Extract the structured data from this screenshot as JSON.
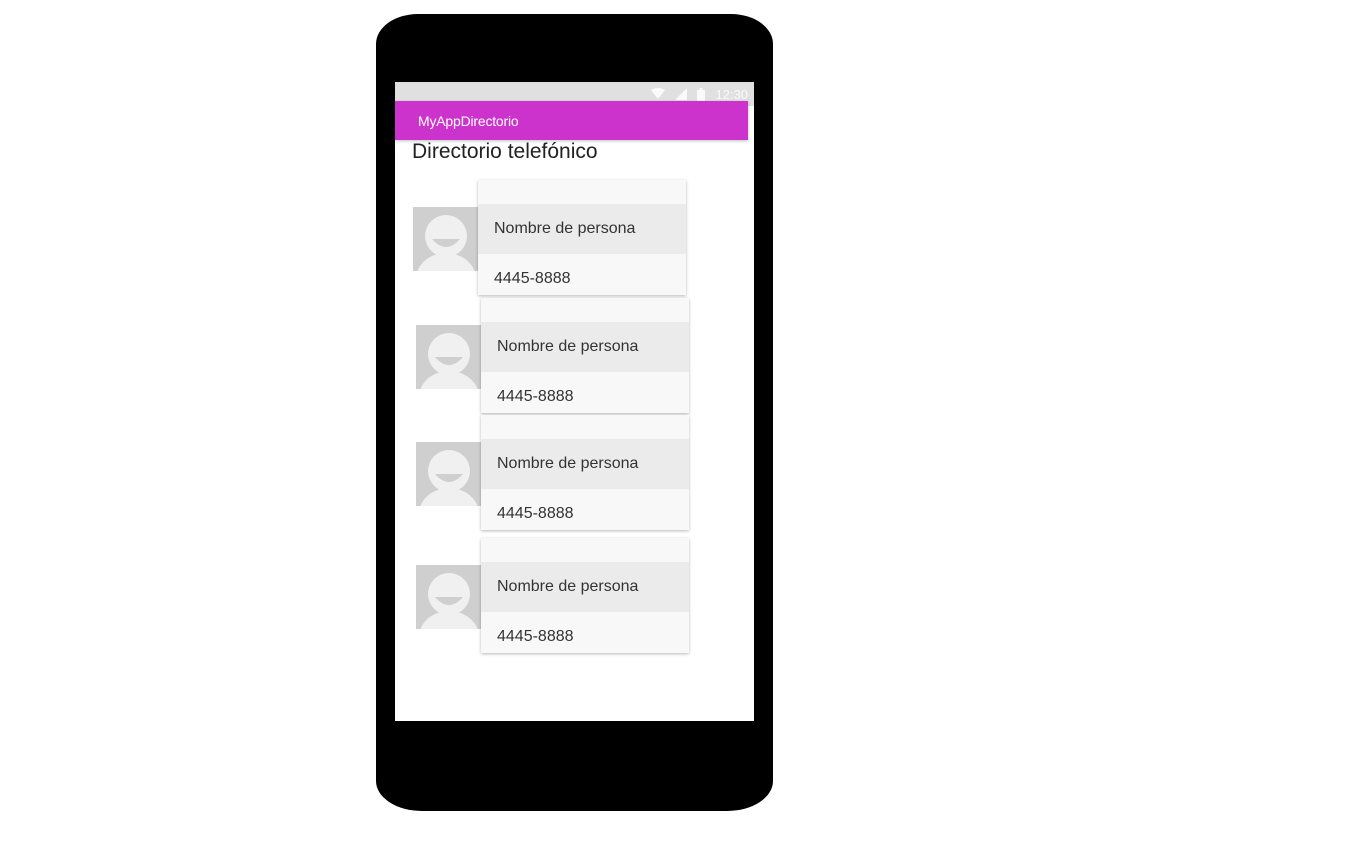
{
  "status_bar": {
    "time": "12:30",
    "icons": [
      "wifi-icon",
      "signal-icon",
      "battery-icon"
    ]
  },
  "app_bar": {
    "title": "MyAppDirectorio",
    "color": "#cc33cc"
  },
  "page": {
    "heading": "Directorio telefónico"
  },
  "contacts": [
    {
      "name": "Nombre de persona",
      "phone": "4445-8888",
      "avatar": "person-placeholder-icon"
    },
    {
      "name": "Nombre de persona",
      "phone": "4445-8888",
      "avatar": "person-placeholder-icon"
    },
    {
      "name": "Nombre de persona",
      "phone": "4445-8888",
      "avatar": "person-placeholder-icon"
    },
    {
      "name": "Nombre de persona",
      "phone": "4445-8888",
      "avatar": "person-placeholder-icon"
    }
  ]
}
